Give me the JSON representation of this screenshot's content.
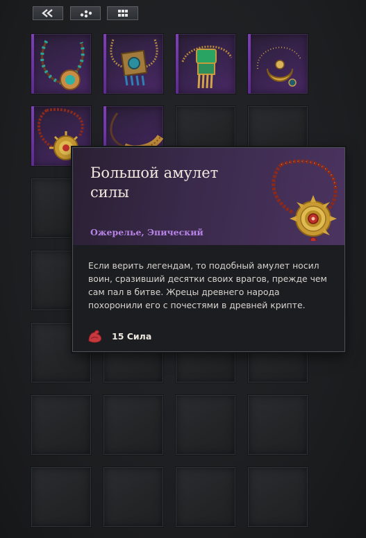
{
  "toolbar": {
    "buttons": [
      {
        "name": "collapse",
        "icon": "double-chevron-left-icon"
      },
      {
        "name": "sort",
        "icon": "dots-cluster-icon"
      },
      {
        "name": "grid-view",
        "icon": "grid-icon"
      }
    ]
  },
  "inventory": {
    "rows": 7,
    "cols": 4,
    "items": [
      {
        "icon": "turquoise-bead-necklace-icon",
        "rarity": "epic"
      },
      {
        "icon": "square-amulet-necklace-icon",
        "rarity": "epic"
      },
      {
        "icon": "jade-plate-necklace-icon",
        "rarity": "epic"
      },
      {
        "icon": "crescent-pendant-necklace-icon",
        "rarity": "epic"
      },
      {
        "icon": "sun-amulet-necklace-icon",
        "rarity": "epic"
      },
      {
        "icon": "gold-torque-necklace-icon",
        "rarity": "epic"
      }
    ]
  },
  "tooltip": {
    "title": "Большой амулет силы",
    "subtitle": "Ожерелье, Эпический",
    "description": "Если верить легендам, то подобный амулет носил воин, сразивший десятки своих врагов, прежде чем сам пал в битве. Жрецы древнего народа похоронили его с почестями в древней крипте.",
    "stat": {
      "icon": "flexed-arm-icon",
      "label": "15 Сила"
    },
    "art_icon": "sun-amulet-necklace-icon"
  },
  "colors": {
    "epic": "#8b4fd0",
    "subtitle": "#b883e6",
    "background": "#1d1e1f"
  }
}
